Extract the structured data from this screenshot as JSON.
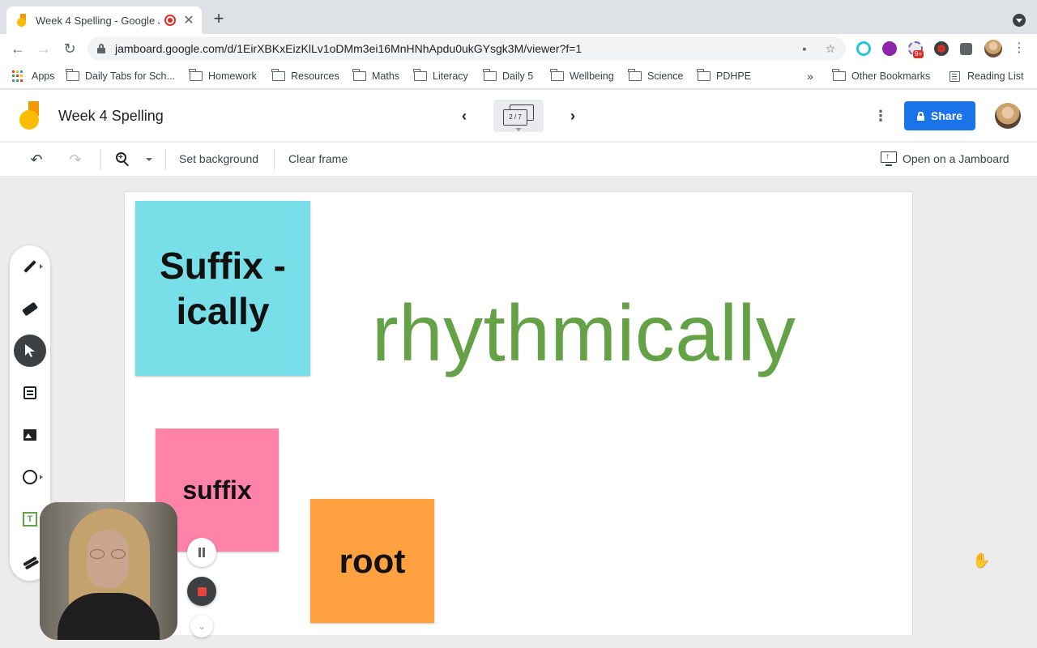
{
  "browser": {
    "tab_title": "Week 4 Spelling - Google J",
    "tab_close": "✕",
    "new_tab": "+",
    "url": "jamboard.google.com/d/1EirXBKxEizKlLv1oDMm3ei16MnHNhApdu0ukGYsgk3M/viewer?f=1",
    "ext_badge": "9+",
    "bookmarks_overflow": "»",
    "bookmarks": [
      "Apps",
      "Daily Tabs for Sch...",
      "Homework",
      "Resources",
      "Maths",
      "Literacy",
      "Daily 5",
      "Wellbeing",
      "Science",
      "PDHPE"
    ],
    "other_bookmarks": "Other Bookmarks",
    "reading_list": "Reading List"
  },
  "jamboard": {
    "title": "Week 4 Spelling",
    "frame_indicator": "2 / 7",
    "share_label": "Share",
    "actions": {
      "set_background": "Set background",
      "clear_frame": "Clear frame",
      "open_on_jamboard": "Open on a Jamboard"
    }
  },
  "canvas": {
    "note_blue": "Suffix -ically",
    "note_pink": "suffix",
    "note_orange": "root",
    "big_word": "rhythmically",
    "colors": {
      "note_blue": "#78dfe8",
      "note_pink": "#ff83a9",
      "note_orange": "#ffa140",
      "big_word": "#65a247"
    }
  },
  "colors": {
    "accent": "#1a73e8",
    "jamboard_orange": "#f29900",
    "jamboard_yellow": "#fbbc04"
  },
  "icons": {
    "undo": "↶",
    "redo": "↷",
    "prev": "‹",
    "next": "›",
    "more": "⋮",
    "back": "←",
    "forward": "→",
    "reload": "↻",
    "star": "☆",
    "camera": "▪"
  }
}
